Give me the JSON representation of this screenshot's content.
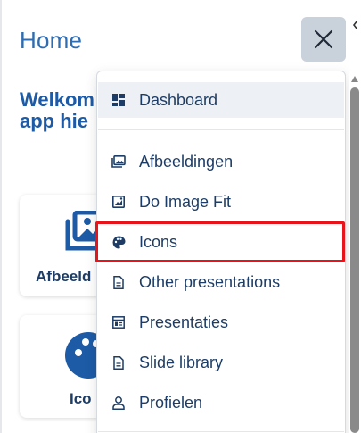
{
  "header": {
    "title": "Home",
    "close_icon": "close-icon"
  },
  "main": {
    "welcome_text": "Welkom",
    "welcome_line2": "app hie",
    "cards": [
      {
        "label": "Afbeeld",
        "icon": "image-gallery-icon"
      },
      {
        "label": "Ico",
        "icon": "palette-icon"
      }
    ]
  },
  "menu": {
    "items": [
      {
        "label": "Dashboard",
        "icon": "dashboard-icon",
        "active": true
      },
      {
        "label": "Afbeeldingen",
        "icon": "image-gallery-icon"
      },
      {
        "label": "Do Image Fit",
        "icon": "image-fit-icon"
      },
      {
        "label": "Icons",
        "icon": "palette-icon",
        "highlighted": true
      },
      {
        "label": "Other presentations",
        "icon": "document-icon"
      },
      {
        "label": "Presentaties",
        "icon": "presentation-icon"
      },
      {
        "label": "Slide library",
        "icon": "document-icon"
      },
      {
        "label": "Profielen",
        "icon": "user-icon"
      }
    ]
  },
  "colors": {
    "accent": "#2f6db0",
    "heading": "#1d5ba6",
    "menu_text": "#1d3d66",
    "highlight": "#e8141b",
    "close_bg": "#c9d1da"
  }
}
